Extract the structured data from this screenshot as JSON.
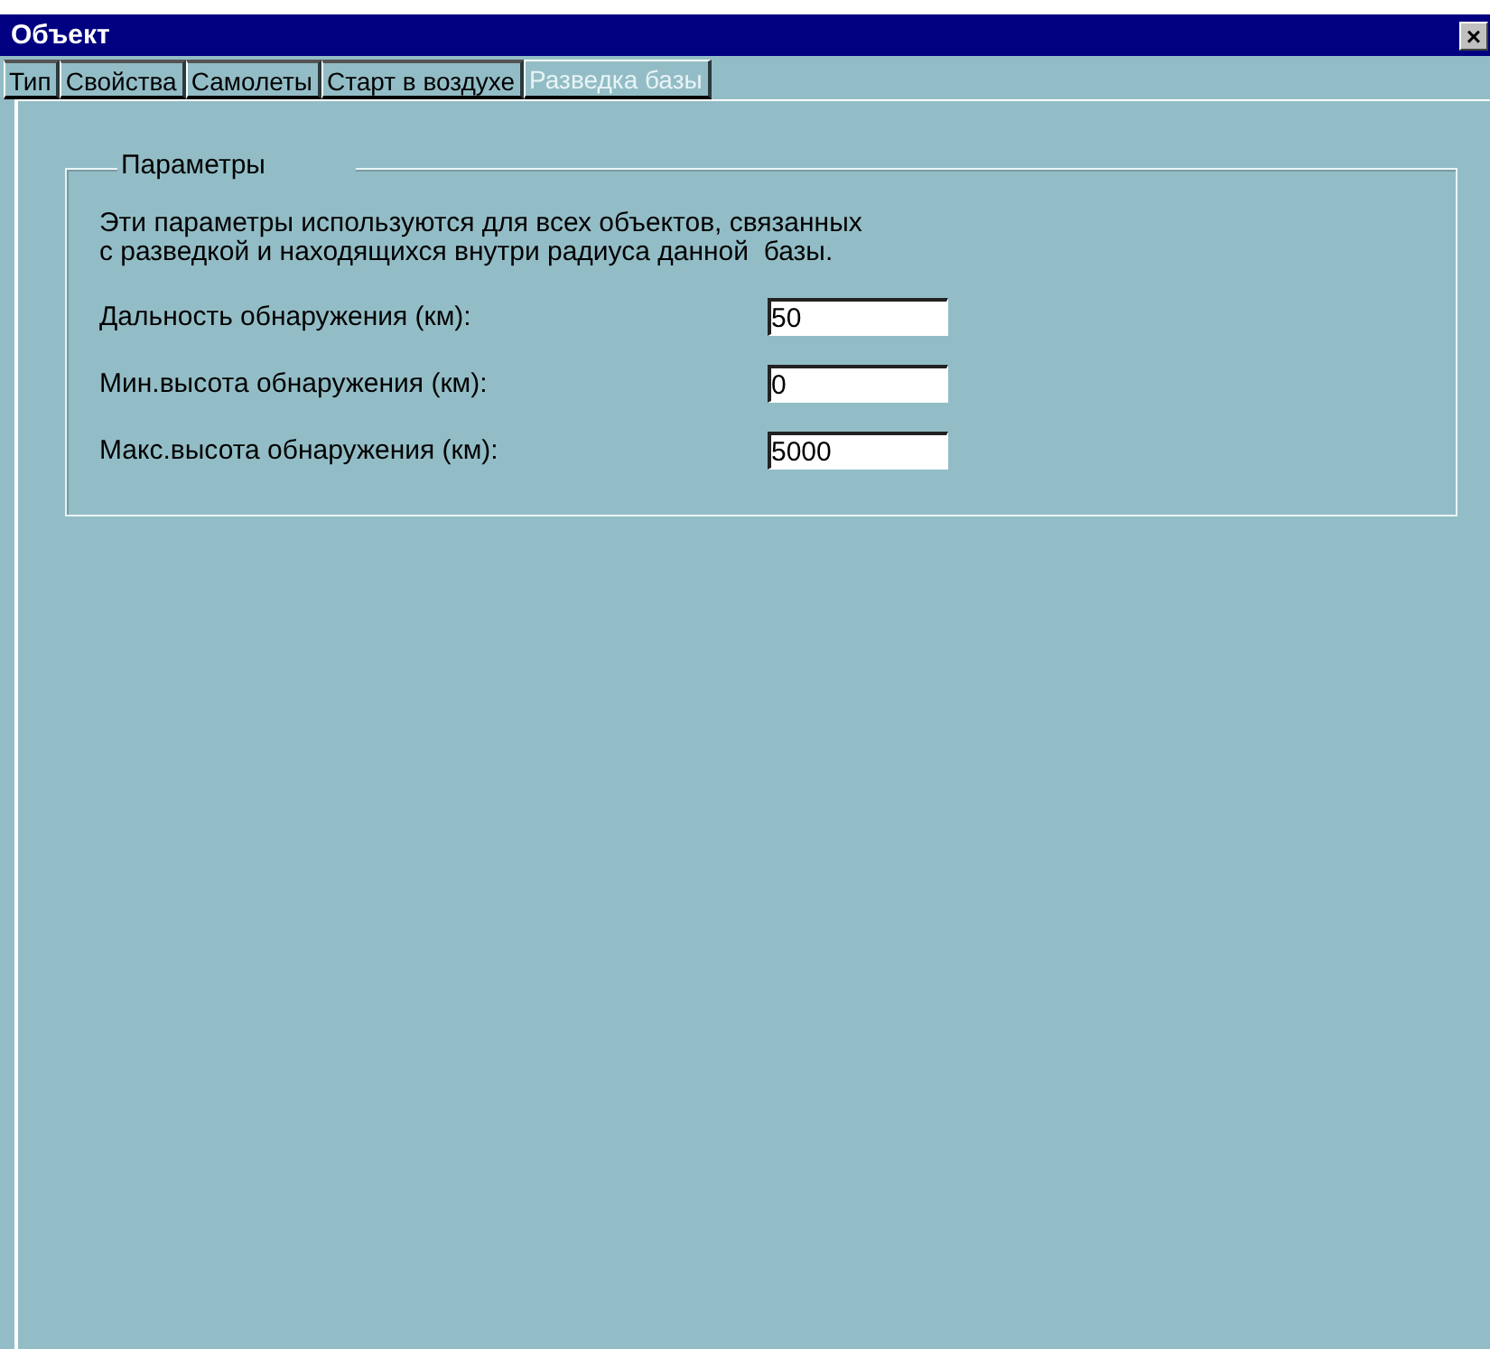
{
  "window": {
    "title": "Объект",
    "close": "×"
  },
  "tabs": [
    {
      "label": "Тип",
      "selected": false
    },
    {
      "label": "Свойства",
      "selected": false
    },
    {
      "label": "Самолеты",
      "selected": false
    },
    {
      "label": "Старт в воздухе",
      "selected": false
    },
    {
      "label": "Разведка базы",
      "selected": true
    }
  ],
  "group": {
    "title": "Параметры",
    "description": "Эти параметры используются для всех объектов, связанных\nс разведкой и находящихся внутри радиуса данной  базы.",
    "fields": [
      {
        "label": "Дальность обнаружения (км):",
        "value": "50"
      },
      {
        "label": "Мин.высота обнаружения (км):",
        "value": "0"
      },
      {
        "label": "Макс.высота обнаружения (км):",
        "value": "5000"
      }
    ]
  }
}
